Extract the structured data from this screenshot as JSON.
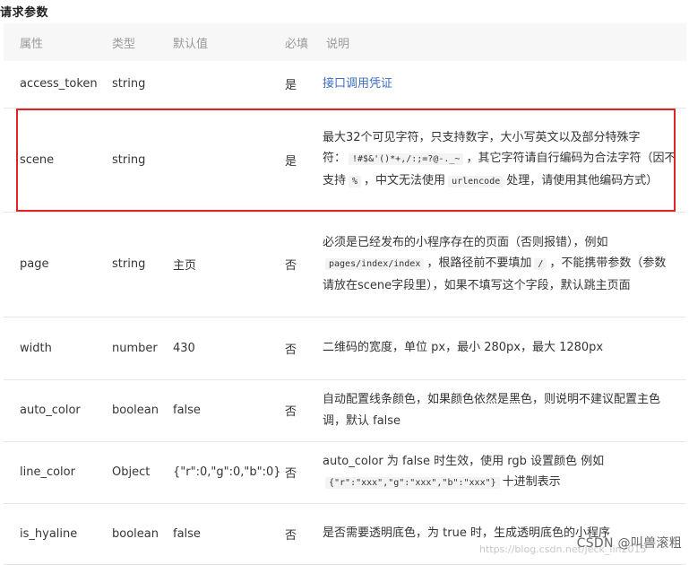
{
  "heading": "请求参数",
  "columns": [
    "属性",
    "类型",
    "默认值",
    "必填",
    "说明"
  ],
  "rows": [
    {
      "name": "access_token",
      "type": "string",
      "default": "",
      "required": "是",
      "desc": [
        {
          "t": "link",
          "v": "接口调用凭证"
        }
      ]
    },
    {
      "name": "scene",
      "type": "string",
      "default": "",
      "required": "是",
      "desc": [
        {
          "t": "text",
          "v": "最大32个可见字符，只支持数字，大小写英文以及部分特殊字符："
        },
        {
          "t": "code",
          "v": "!#$&'()*+,/:;=?@-._~"
        },
        {
          "t": "text",
          "v": "，其它字符请自行编码为合法字符（因不支持"
        },
        {
          "t": "code",
          "v": "%"
        },
        {
          "t": "text",
          "v": "，中文无法使用"
        },
        {
          "t": "code",
          "v": "urlencode"
        },
        {
          "t": "text",
          "v": "处理，请使用其他编码方式）"
        }
      ]
    },
    {
      "name": "page",
      "type": "string",
      "default": "主页",
      "required": "否",
      "desc": [
        {
          "t": "text",
          "v": "必须是已经发布的小程序存在的页面（否则报错），例如"
        },
        {
          "t": "code",
          "v": "pages/index/index"
        },
        {
          "t": "text",
          "v": "，根路径前不要填加"
        },
        {
          "t": "code",
          "v": "/"
        },
        {
          "t": "text",
          "v": "，不能携带参数（参数请放在scene字段里），如果不填写这个字段，默认跳主页面"
        }
      ]
    },
    {
      "name": "width",
      "type": "number",
      "default": "430",
      "required": "否",
      "desc": [
        {
          "t": "text",
          "v": "二维码的宽度，单位 px，最小 280px，最大 1280px"
        }
      ]
    },
    {
      "name": "auto_color",
      "type": "boolean",
      "default": "false",
      "required": "否",
      "desc": [
        {
          "t": "text",
          "v": "自动配置线条颜色，如果颜色依然是黑色，则说明不建议配置主色调，默认 false"
        }
      ]
    },
    {
      "name": "line_color",
      "type": "Object",
      "default": "{\"r\":0,\"g\":0,\"b\":0}",
      "required": "否",
      "desc": [
        {
          "t": "text",
          "v": "auto_color 为 false 时生效，使用 rgb 设置颜色 例如"
        },
        {
          "t": "code",
          "v": "{\"r\":\"xxx\",\"g\":\"xxx\",\"b\":\"xxx\"}"
        },
        {
          "t": "text",
          "v": "十进制表示"
        }
      ]
    },
    {
      "name": "is_hyaline",
      "type": "boolean",
      "default": "false",
      "required": "否",
      "desc": [
        {
          "t": "text",
          "v": "是否需要透明底色，为 true 时，生成透明底色的小程序"
        }
      ]
    }
  ],
  "watermark": "CSDN @叫兽滚粗",
  "watermark_faint": "https://blog.csdn.net/jeck_lin2015",
  "colors": {
    "highlight_border": "#e02424",
    "link": "#3b6fc4",
    "header_bg": "#f7f7f7"
  }
}
